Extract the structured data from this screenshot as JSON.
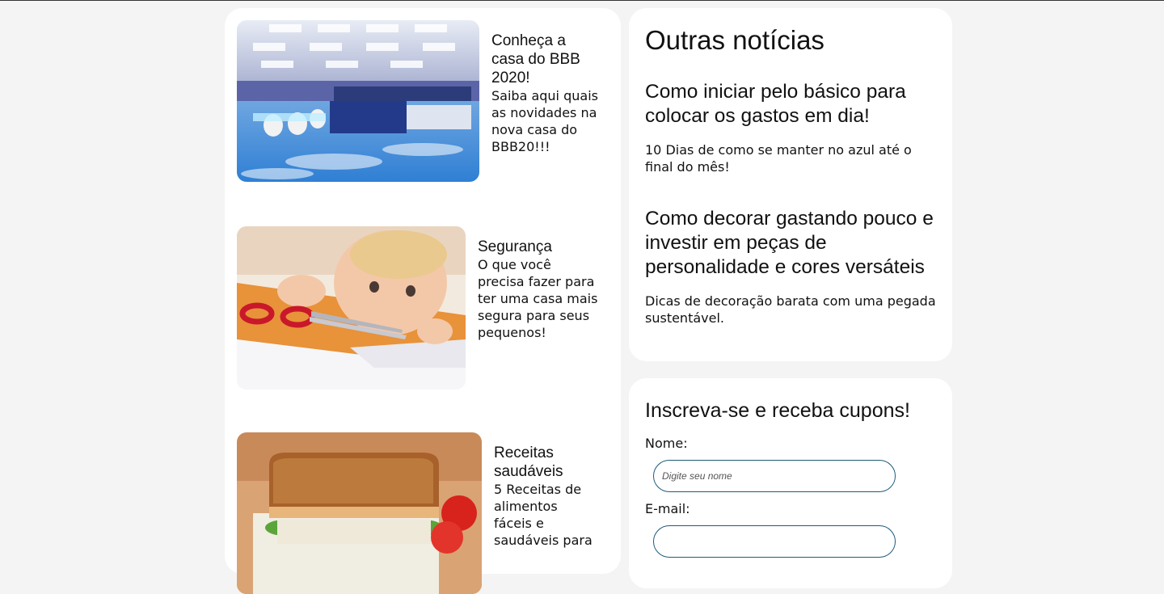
{
  "articles": [
    {
      "title": "Conheça a casa do BBB 2020!",
      "description": "Saiba aqui quais as novidades na nova casa do BBB20!!!"
    },
    {
      "title": "Segurança",
      "description": "O que você precisa fazer para ter uma casa mais segura para seus pequenos!"
    },
    {
      "title": "Receitas saudáveis",
      "description": "5 Receitas de alimentos fáceis e saudáveis para"
    }
  ],
  "news": {
    "heading": "Outras notícias",
    "items": [
      {
        "title": "Como iniciar pelo básico para colocar os gastos em dia!",
        "description": "10 Dias de como se manter no azul até o final do mês!"
      },
      {
        "title": "Como decorar gastando pouco e investir em peças de personalidade e cores versáteis",
        "description": "Dicas de decoração barata com uma pegada sustentável."
      }
    ]
  },
  "subscribe": {
    "heading": "Inscreva-se e receba cupons!",
    "name_label": "Nome:",
    "name_placeholder": "Digite seu nome",
    "email_label": "E-mail:"
  }
}
